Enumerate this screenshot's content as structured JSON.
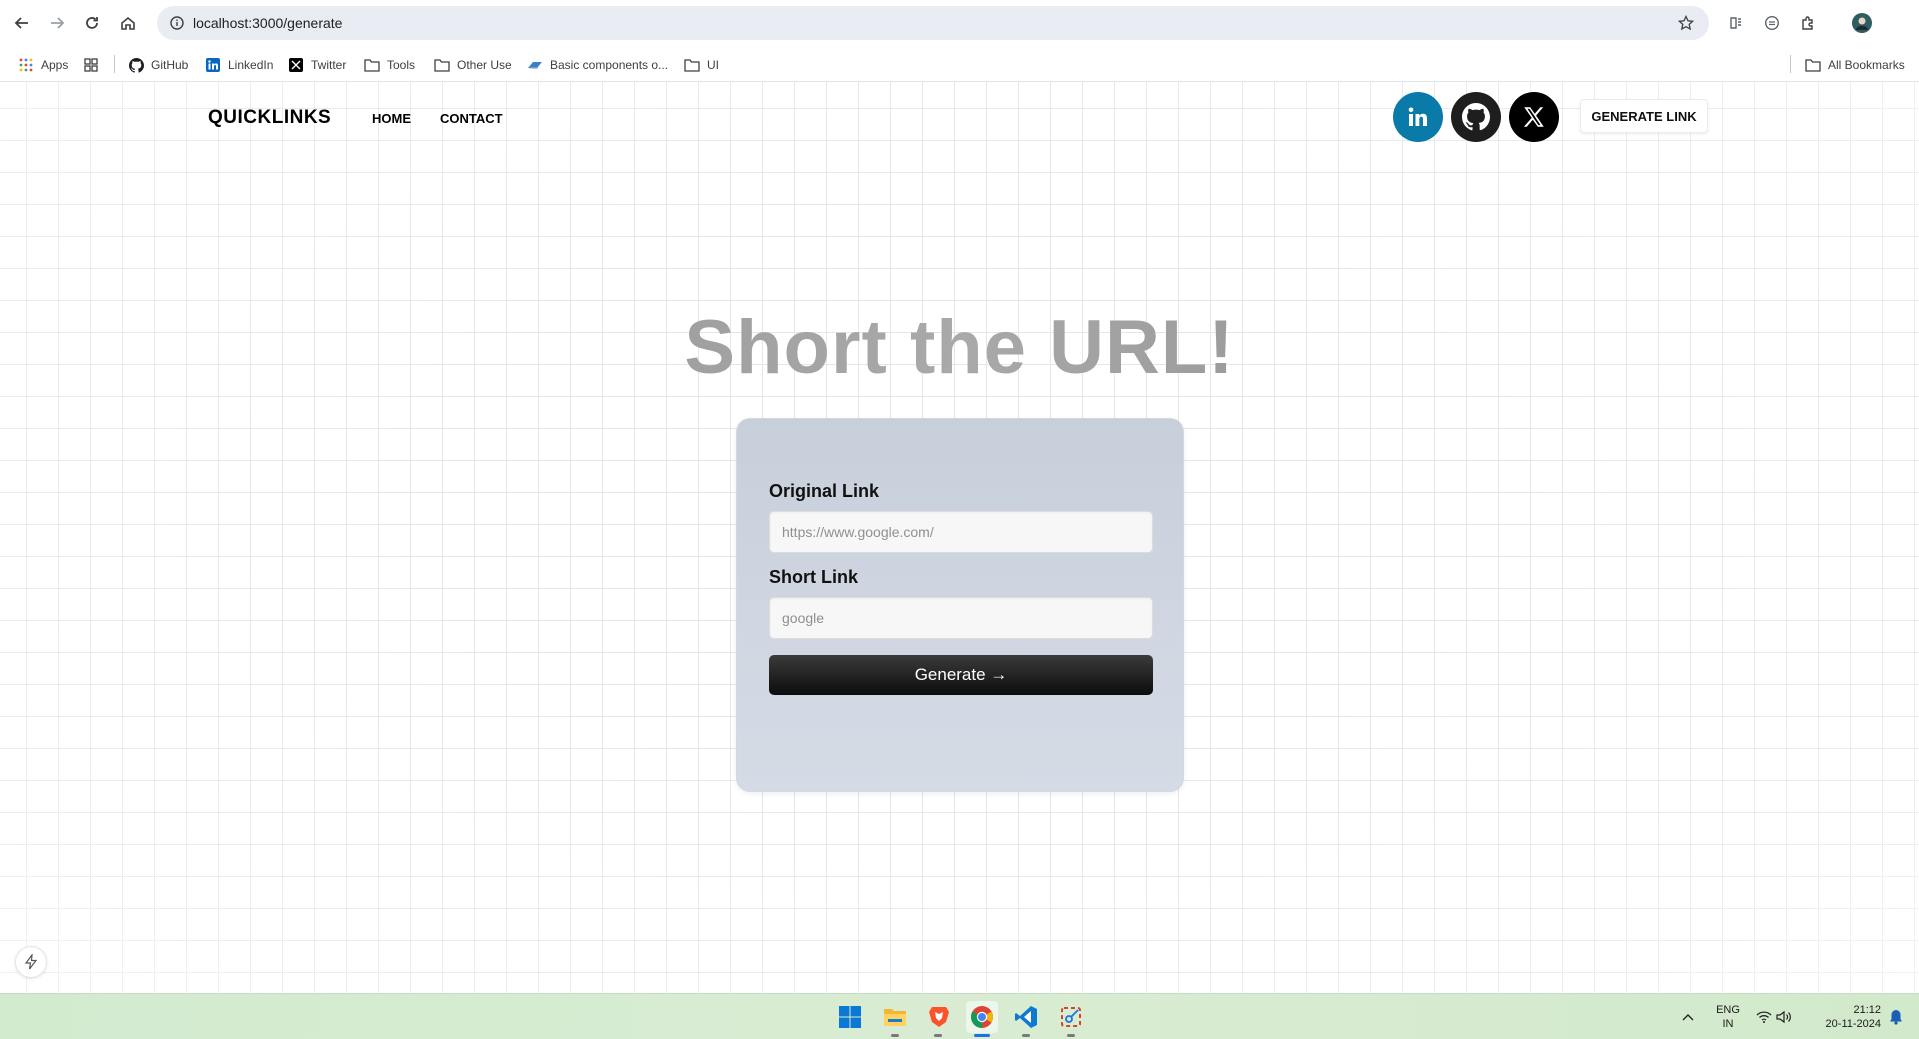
{
  "browser": {
    "url": "localhost:3000/generate",
    "bookmarks": [
      {
        "label": "Apps",
        "icon": "apps-grid-icon"
      },
      {
        "label": "",
        "icon": "tab-groups-icon"
      },
      {
        "label": "GitHub",
        "icon": "github-icon"
      },
      {
        "label": "LinkedIn",
        "icon": "linkedin-icon"
      },
      {
        "label": "Twitter",
        "icon": "x-icon"
      },
      {
        "label": "Tools",
        "icon": "folder-icon"
      },
      {
        "label": "Other Use",
        "icon": "folder-icon"
      },
      {
        "label": "Basic components o...",
        "icon": "link-icon"
      },
      {
        "label": "UI",
        "icon": "folder-icon"
      }
    ],
    "all_bookmarks": "All Bookmarks"
  },
  "site": {
    "brand": "QUICKLINKS",
    "nav": {
      "home": "HOME",
      "contact": "CONTACT"
    },
    "cta": "GENERATE LINK",
    "socials": [
      {
        "name": "linkedin",
        "color": "#0a7aa8"
      },
      {
        "name": "github",
        "color": "#1e1e1e"
      },
      {
        "name": "x",
        "color": "#000000"
      }
    ]
  },
  "hero": {
    "title": "Short the URL!"
  },
  "form": {
    "original_label": "Original Link",
    "original_placeholder": "https://www.google.com/",
    "short_label": "Short Link",
    "short_placeholder": "google",
    "submit": "Generate →"
  },
  "taskbar": {
    "lang_top": "ENG",
    "lang_bottom": "IN",
    "time": "21:12",
    "date": "20-11-2024"
  }
}
